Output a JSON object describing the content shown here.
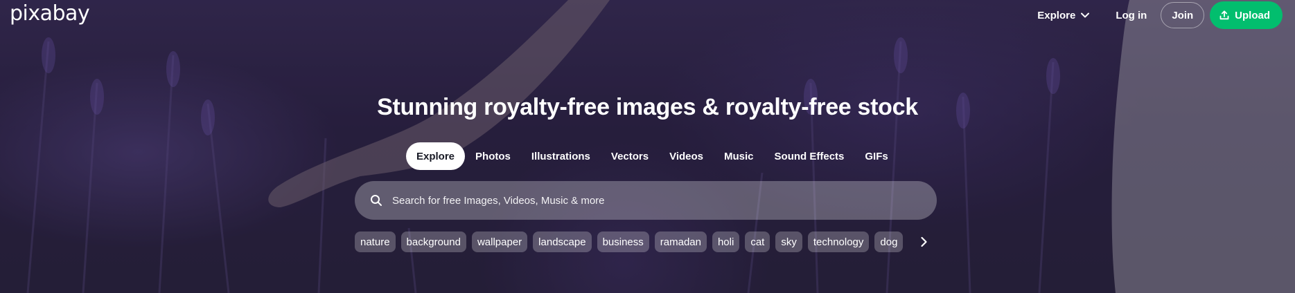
{
  "brand": {
    "logo_text": "pixabay"
  },
  "nav": {
    "explore_label": "Explore",
    "login_label": "Log in",
    "join_label": "Join",
    "upload_label": "Upload",
    "upload_color": "#02be6e"
  },
  "hero": {
    "headline": "Stunning royalty-free images & royalty-free stock"
  },
  "tabs": [
    {
      "label": "Explore",
      "active": true
    },
    {
      "label": "Photos"
    },
    {
      "label": "Illustrations"
    },
    {
      "label": "Vectors"
    },
    {
      "label": "Videos"
    },
    {
      "label": "Music"
    },
    {
      "label": "Sound Effects"
    },
    {
      "label": "GIFs"
    }
  ],
  "search": {
    "placeholder": "Search for free Images, Videos, Music & more",
    "value": ""
  },
  "chips": [
    "nature",
    "background",
    "wallpaper",
    "landscape",
    "business",
    "ramadan",
    "holi",
    "cat",
    "sky",
    "technology",
    "dog"
  ],
  "icons": {
    "explore_caret": "chevron-down-icon",
    "upload": "upload-icon",
    "search": "search-icon",
    "chips_next": "chevron-right-icon"
  }
}
